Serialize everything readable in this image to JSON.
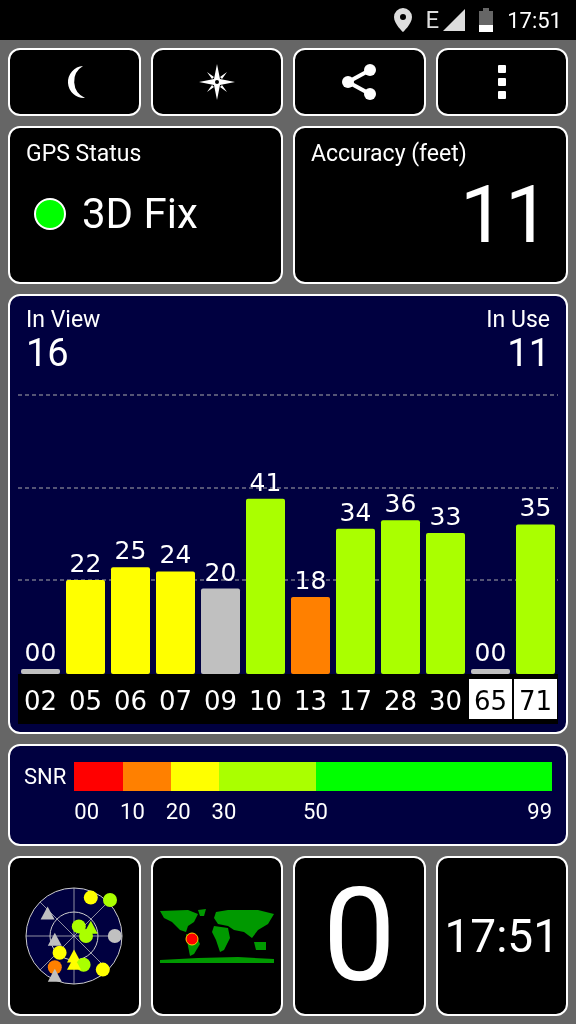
{
  "status_bar": {
    "network": "E",
    "time": "17:51"
  },
  "toolbar": {
    "buttons": [
      {
        "kind": "night"
      },
      {
        "kind": "compass"
      },
      {
        "kind": "share"
      },
      {
        "kind": "more"
      }
    ]
  },
  "gps_status": {
    "title": "GPS Status",
    "value": "3D Fix",
    "color": "#00ff00"
  },
  "accuracy": {
    "title": "Accuracy (feet)",
    "value": "11"
  },
  "satellites": {
    "in_view_label": "In View",
    "in_view": "16",
    "in_use_label": "In Use",
    "in_use": "11",
    "chart_data": {
      "type": "bar",
      "categories": [
        "02",
        "05",
        "06",
        "07",
        "09",
        "10",
        "13",
        "17",
        "28",
        "30",
        "65",
        "71"
      ],
      "values": [
        0,
        22,
        25,
        24,
        20,
        41,
        18,
        34,
        36,
        33,
        0,
        35
      ],
      "value_labels": [
        "00",
        "22",
        "25",
        "24",
        "20",
        "41",
        "18",
        "34",
        "36",
        "33",
        "00",
        "35"
      ],
      "ylim": [
        0,
        66
      ]
    },
    "flags": [
      {
        "in_use": false,
        "marked": false
      },
      {
        "in_use": true,
        "marked": false
      },
      {
        "in_use": true,
        "marked": false
      },
      {
        "in_use": true,
        "marked": false
      },
      {
        "in_use": false,
        "marked": false
      },
      {
        "in_use": true,
        "marked": false
      },
      {
        "in_use": true,
        "marked": false
      },
      {
        "in_use": true,
        "marked": false
      },
      {
        "in_use": true,
        "marked": false
      },
      {
        "in_use": true,
        "marked": false
      },
      {
        "in_use": false,
        "marked": true
      },
      {
        "in_use": true,
        "marked": true
      }
    ]
  },
  "snr_legend": {
    "title": "SNR",
    "segments": [
      {
        "color": "#ff0000"
      },
      {
        "color": "#ff8000"
      },
      {
        "color": "#ffff00"
      },
      {
        "color": "#aaff00"
      },
      {
        "color": "#00ff00"
      }
    ],
    "ticks": [
      "00",
      "10",
      "20",
      "30",
      "50",
      "99"
    ]
  },
  "tiles": {
    "count": "0",
    "time": "17:51"
  }
}
